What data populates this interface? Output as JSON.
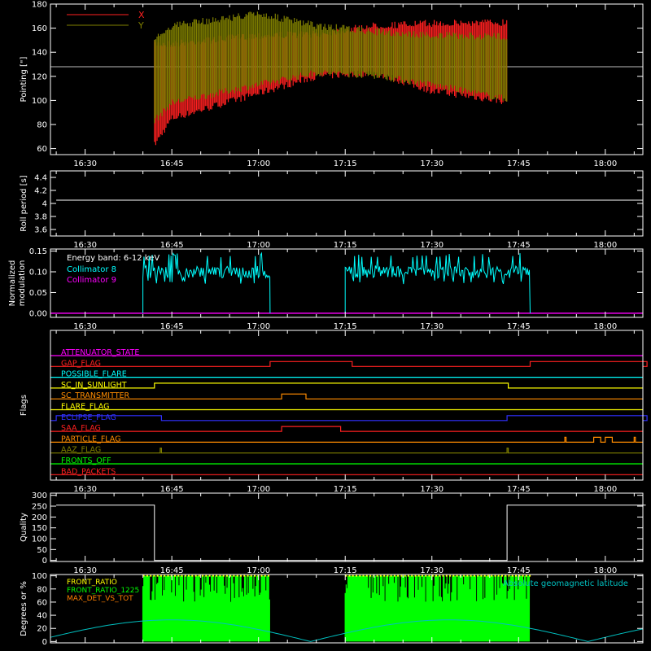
{
  "colors": {
    "background": "#000000",
    "axes": "#ffffff",
    "x_series": "#ff2020",
    "y_series": "#7f7f00",
    "reference": "#bbbbbb",
    "collimator8": "#00ffff",
    "collimator9": "#ff00ff",
    "latitude": "#00c0c0",
    "front_ratio": "#ffff00",
    "front_ratio_1225": "#00ff00",
    "max_det": "#ff7f00"
  },
  "time_ticks": [
    "16:30",
    "16:45",
    "17:00",
    "17:15",
    "17:30",
    "17:45",
    "18:00"
  ],
  "chart_data": [
    {
      "type": "line",
      "ylabel": "Pointing [\"]",
      "ylim": [
        55,
        180
      ],
      "yticks": [
        60,
        80,
        100,
        120,
        140,
        160,
        180
      ],
      "legend": [
        "X",
        "Y"
      ],
      "legend_placement": "top-left",
      "reference_line": 128,
      "data_window": [
        "16:42",
        "17:43"
      ],
      "series": [
        {
          "name": "X",
          "x": [
            "16:42",
            "16:45",
            "17:00",
            "17:10",
            "17:20",
            "17:30",
            "17:43"
          ],
          "max": [
            150,
            150,
            157,
            158,
            165,
            167,
            168
          ],
          "min": [
            60,
            82,
            103,
            117,
            120,
            105,
            96
          ]
        },
        {
          "name": "Y",
          "x": [
            "16:42",
            "16:45",
            "17:00",
            "17:10",
            "17:20",
            "17:30",
            "17:43"
          ],
          "max": [
            155,
            165,
            175,
            165,
            160,
            157,
            156
          ],
          "min": [
            80,
            95,
            110,
            120,
            118,
            110,
            98
          ]
        }
      ]
    },
    {
      "type": "line",
      "ylabel": "Roll period [s]",
      "ylim": [
        3.5,
        4.5
      ],
      "yticks": [
        3.6,
        3.8,
        4.0,
        4.2,
        4.4
      ],
      "series": [
        {
          "x": [
            "16:25",
            "18:07"
          ],
          "y": [
            4.05,
            4.05
          ]
        }
      ]
    },
    {
      "type": "line",
      "ylabel": "Normalized modulation",
      "ylim": [
        -0.01,
        0.155
      ],
      "yticks": [
        "0.00",
        "0.05",
        "0.10",
        "0.15"
      ],
      "annotation": "Energy band: 6-12 keV",
      "legend": [
        "Collimator 8",
        "Collimator 9"
      ],
      "series": [
        {
          "name": "Collimator 8",
          "segments": [
            [
              "16:40",
              "17:02"
            ],
            [
              "17:15",
              "17:47"
            ]
          ],
          "typical": 0.1,
          "range": [
            0.07,
            0.145
          ]
        },
        {
          "name": "Collimator 9",
          "x": [
            "16:25",
            "18:07"
          ],
          "y": [
            0,
            0
          ]
        }
      ]
    },
    {
      "type": "table",
      "ylabel": "Flags",
      "flags": [
        {
          "name": "ATTENUATOR_STATE",
          "color": "#ff00ff",
          "high": []
        },
        {
          "name": "GAP_FLAG",
          "color": "#ff2020",
          "high": [
            [
              "17:02",
              "17:16"
            ],
            [
              "17:47",
              "18:07"
            ]
          ]
        },
        {
          "name": "POSSIBLE_FLARE",
          "color": "#00ffff",
          "high": []
        },
        {
          "name": "SC_IN_SUNLIGHT",
          "color": "#ffff00",
          "high": [
            [
              "16:42",
              "17:43"
            ]
          ]
        },
        {
          "name": "SC_TRANSMITTER",
          "color": "#ff8c00",
          "high": [
            [
              "17:04",
              "17:08"
            ]
          ]
        },
        {
          "name": "FLARE_FLAG",
          "color": "#ffff00",
          "high": []
        },
        {
          "name": "ECLIPSE_FLAG",
          "color": "#3030ff",
          "high": [
            [
              "16:25",
              "16:43"
            ],
            [
              "17:43",
              "18:07"
            ]
          ]
        },
        {
          "name": "SAA_FLAG",
          "color": "#ff2020",
          "high": [
            [
              "17:04",
              "17:14"
            ]
          ]
        },
        {
          "name": "PARTICLE_FLAG",
          "color": "#ff8c00",
          "high": [
            [
              "17:53",
              "17:53"
            ],
            [
              "17:58",
              "17:59"
            ],
            [
              "18:00",
              "18:01"
            ],
            [
              "18:05",
              "18:05"
            ]
          ]
        },
        {
          "name": "AAZ_FLAG",
          "color": "#808000",
          "high": [
            [
              "16:43",
              "16:43"
            ],
            [
              "17:43",
              "17:43"
            ]
          ]
        },
        {
          "name": "FRONTS_OFF",
          "color": "#00ff00",
          "high": []
        },
        {
          "name": "BAD_PACKETS",
          "color": "#ff2020",
          "high": []
        }
      ]
    },
    {
      "type": "line",
      "ylabel": "Quality",
      "ylim": [
        -5,
        310
      ],
      "yticks": [
        0,
        50,
        100,
        150,
        200,
        250,
        300
      ],
      "series": [
        {
          "x": [
            "16:25",
            "16:42",
            "16:42",
            "17:43",
            "17:43",
            "18:07"
          ],
          "y": [
            255,
            255,
            0,
            0,
            255,
            255
          ]
        }
      ]
    },
    {
      "type": "line",
      "ylabel": "Degrees or %",
      "ylim": [
        -2,
        102
      ],
      "yticks": [
        0,
        20,
        40,
        60,
        80,
        100
      ],
      "legend": [
        "FRONT_RATIO",
        "FRONT_RATIO_1225",
        "MAX_DET_VS_TOT"
      ],
      "right_legend": "Absolute geomagnetic latitude",
      "series": [
        {
          "name": "FRONT_RATIO_1225",
          "segments": [
            [
              "16:40",
              "17:02"
            ],
            [
              "17:15",
              "17:47"
            ]
          ],
          "range": [
            0,
            100
          ]
        },
        {
          "name": "Absolute geomagnetic latitude",
          "x": [
            "16:25",
            "16:45",
            "17:09",
            "17:33",
            "17:57",
            "18:07"
          ],
          "y": [
            3,
            33,
            0,
            33,
            0,
            18
          ]
        }
      ]
    }
  ]
}
